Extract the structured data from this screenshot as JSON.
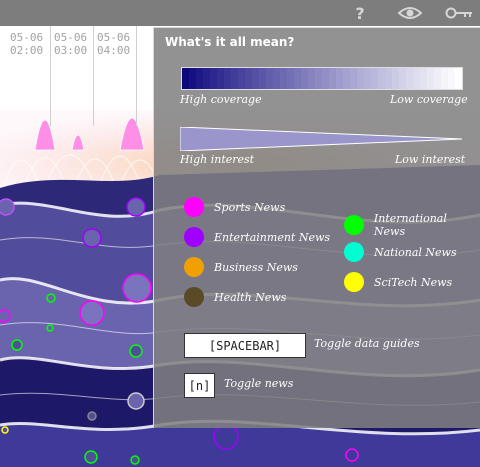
{
  "timeline": {
    "ticks": [
      {
        "date": "05-06",
        "time": "02:00"
      },
      {
        "date": "05-06",
        "time": "03:00"
      },
      {
        "date": "05-06",
        "time": "04:00"
      }
    ]
  },
  "toolbar": {
    "help_icon": "help-icon",
    "view_icon": "eye-icon",
    "key_icon": "key-icon"
  },
  "legend_panel": {
    "title": "What's it all mean?",
    "coverage": {
      "high_label": "High coverage",
      "low_label": "Low coverage",
      "start_color": "#0d0840",
      "end_color": "#ffffff"
    },
    "interest": {
      "high_label": "High interest",
      "low_label": "Low interest",
      "color": "#9a96cc"
    },
    "categories_left": [
      {
        "label": "Sports News",
        "color": "#ff00ff"
      },
      {
        "label": "Entertainment News",
        "color": "#a000ff"
      },
      {
        "label": "Business News",
        "color": "#f0a000"
      },
      {
        "label": "Health News",
        "color": "#5a4a28"
      }
    ],
    "categories_right": [
      {
        "label": "International News",
        "color": "#00ff00"
      },
      {
        "label": "National News",
        "color": "#00ffd0"
      },
      {
        "label": "SciTech News",
        "color": "#ffff00"
      }
    ],
    "keys": [
      {
        "key": "[SPACEBAR]",
        "action": "Toggle data guides"
      },
      {
        "key": "[n]",
        "action": "Toggle news"
      }
    ]
  }
}
